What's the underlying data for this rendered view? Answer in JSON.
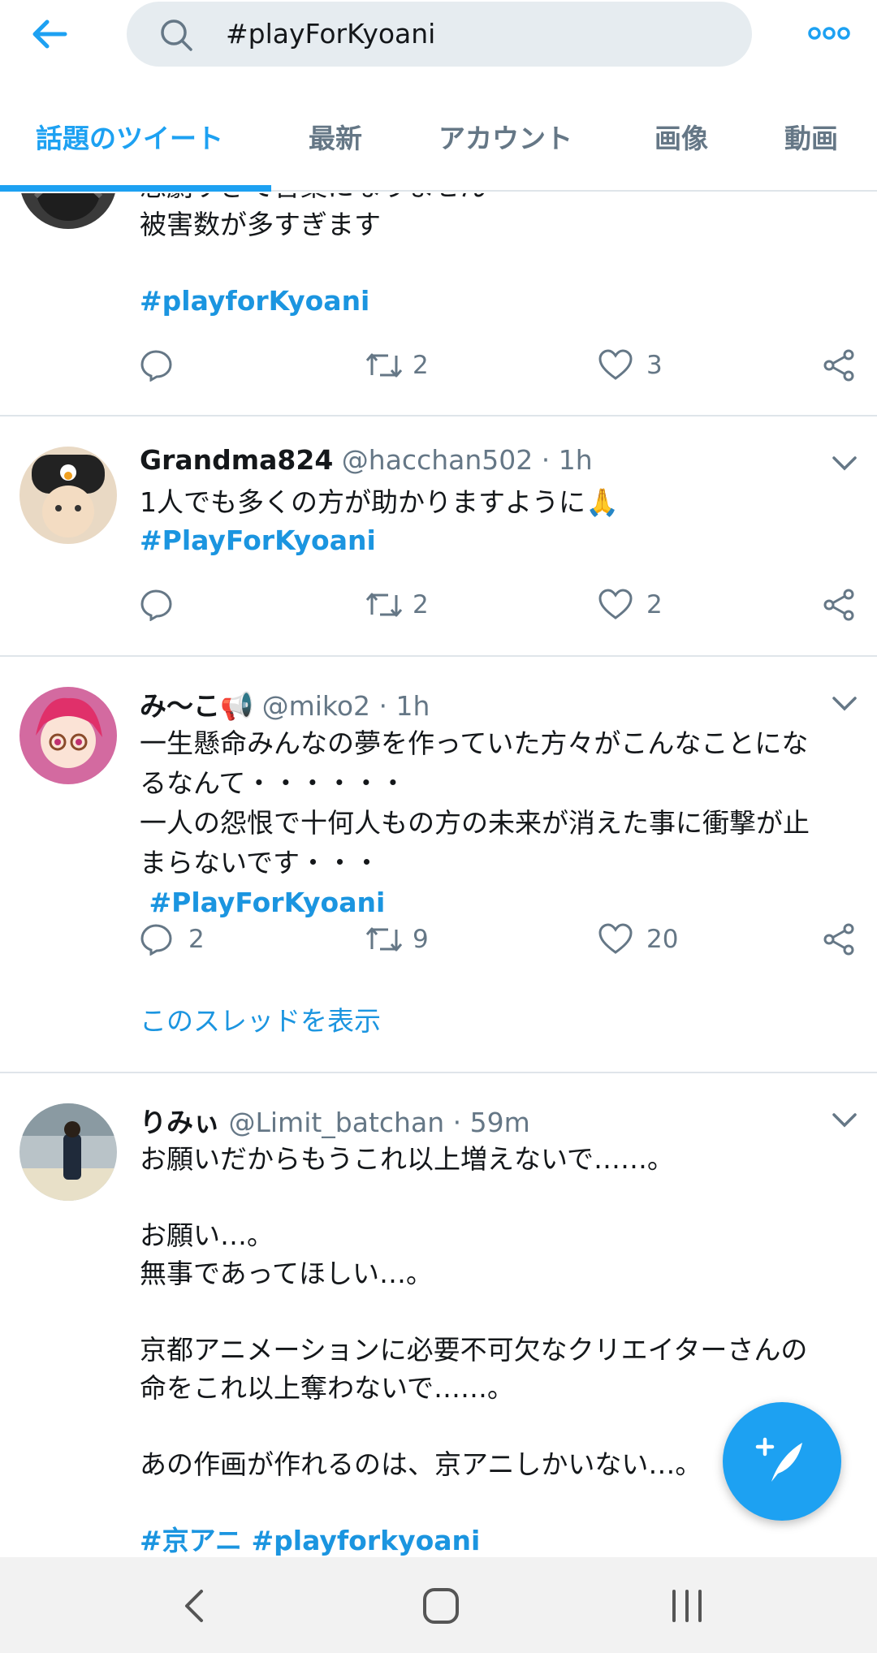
{
  "search": {
    "query": "#playForKyoani"
  },
  "tabs": [
    {
      "label": "話題のツイート"
    },
    {
      "label": "最新"
    },
    {
      "label": "アカウント"
    },
    {
      "label": "画像"
    },
    {
      "label": "動画"
    }
  ],
  "tweets": [
    {
      "partial_line": "悲劇すぎて言葉になりません",
      "lines": [
        "被害数が多すぎます"
      ],
      "hashtag": "#playforKyoani",
      "retweets": "2",
      "likes": "3"
    },
    {
      "name": "Grandma824",
      "handle": "@hacchan502",
      "sep": "·",
      "time": "1h",
      "text": "1人でも多くの方が助かりますように🙏",
      "hashtag": "#PlayForKyoani",
      "retweets": "2",
      "likes": "2"
    },
    {
      "name": "み〜こ📢",
      "handle": "@miko2",
      "sep": "·",
      "time": "1h",
      "lines": [
        "一生懸命みんなの夢を作っていた方々がこんなことにな",
        "るなんて・・・・・・",
        "一人の怨恨で十何人もの方の未来が消えた事に衝撃が止",
        "まらないです・・・"
      ],
      "hashtag": " #PlayForKyoani",
      "replies": "2",
      "retweets": "9",
      "likes": "20",
      "thread_link": "このスレッドを表示"
    },
    {
      "name": "りみぃ",
      "handle": "@Limit_batchan",
      "sep": "·",
      "time": "59m",
      "lines": [
        "お願いだからもうこれ以上増えないで……。",
        "",
        "お願い…。",
        "無事であってほしい…。",
        "",
        "京都アニメーションに必要不可欠なクリエイターさんの",
        "命をこれ以上奪わないで……。",
        "",
        "あの作画が作れるのは、京アニしかいない…。"
      ],
      "hashtags_partial": "#京アニ #playforkyoani"
    }
  ],
  "colors": {
    "accent": "#1da1f2",
    "link": "#1b95e0",
    "muted": "#657786",
    "divider": "#dfe5ea"
  },
  "icons": [
    "back-arrow-icon",
    "search-icon",
    "more-options-icon",
    "reply-icon",
    "retweet-icon",
    "like-icon",
    "share-icon",
    "caret-down-icon",
    "compose-icon",
    "nav-back-icon",
    "nav-home-icon",
    "nav-recents-icon"
  ]
}
